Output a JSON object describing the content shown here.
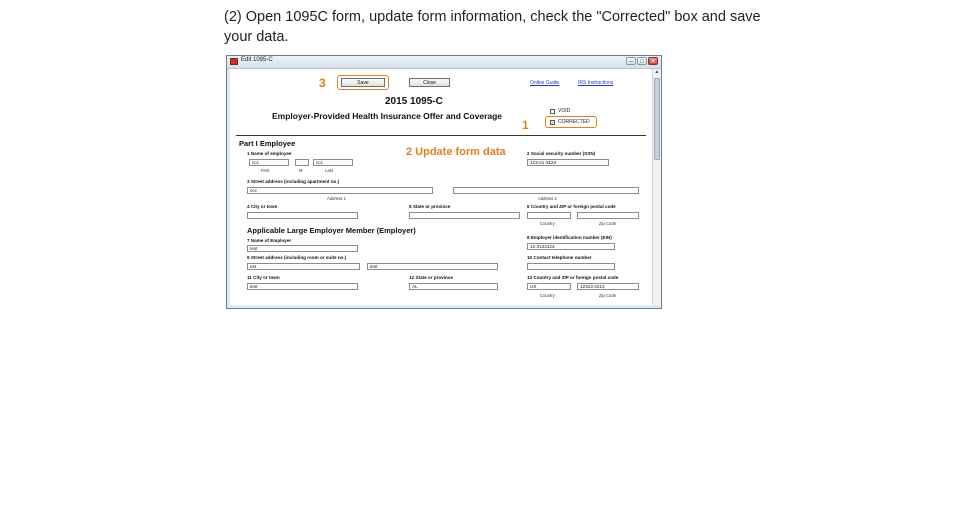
{
  "instruction": "(2) Open 1095C form, update form information, check the \"Corrected\" box and save your data.",
  "window": {
    "title": "Edit 1095-C",
    "controls": {
      "minimize": "─",
      "maximize": "□",
      "close": "✕"
    }
  },
  "toolbar": {
    "save_label": "Save",
    "close_label": "Close",
    "online_guide": "Online Guide",
    "irs_instructions": "IRS Instructions"
  },
  "form": {
    "year": "2015 1095-C",
    "title": "Employer-Provided Health Insurance Offer and Coverage",
    "void_label": "VOID",
    "void_checked": false,
    "corrected_label": "CORRECTED",
    "corrected_checked": true,
    "check_mark": "✓"
  },
  "annotations": {
    "step1": "1",
    "step2": "2 Update form data",
    "step3": "3",
    "color": "#e07f1f"
  },
  "part1": {
    "heading": "Part I Employee",
    "name_label": "1 Name of employee",
    "first": "ccc",
    "middle": "",
    "last": "ccc",
    "first_sub": "First",
    "middle_sub": "M",
    "last_sub": "Last",
    "ssn_label": "2 Social security number (SSN)",
    "ssn": "123-21-3123",
    "address_label": "3 Street address (including apartment no.)",
    "address1": "ccc",
    "address2": "",
    "address1_sub": "Address 1",
    "address2_sub": "Address 2",
    "city_label": "4 City or town",
    "city": "",
    "state_label": "5 State or province",
    "state": "",
    "country_label": "6 Country and ZIP or foreign postal code",
    "country": "",
    "zip": "",
    "country_sub": "Country",
    "zip_sub": "Zip Code"
  },
  "employer": {
    "heading": "Applicable Large Employer Member (Employer)",
    "name_label": "7 Name of Employer",
    "name": "test",
    "ein_label": "8 Employer identification number (EIN)",
    "ein": "12-3123123",
    "address_label": "9 Street address (including room or suite no.)",
    "address1": "est",
    "address2": "test",
    "phone_label": "10 Contact telephone number",
    "phone": "",
    "city_label": "11 City or town",
    "city": "test",
    "state_label": "12 State or province",
    "state": "AL",
    "country_label": "13 Country and ZIP or foreign postal code",
    "country": "US",
    "zip": "12313-2213",
    "country_sub": "Country",
    "zip_sub": "Zip Code"
  },
  "scrollbar": {
    "up_arrow": "▲"
  }
}
